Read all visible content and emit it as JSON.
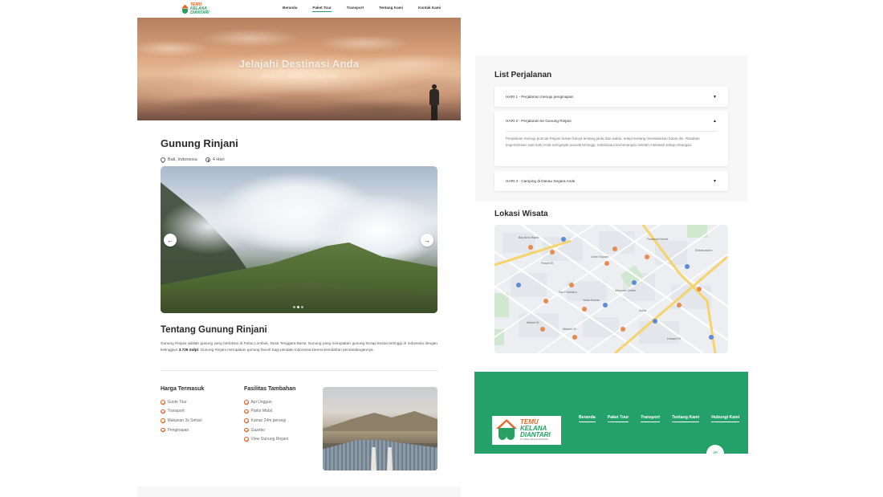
{
  "brand": {
    "logo_line1": "TEMU",
    "logo_line2": "KELANA",
    "logo_line3": "DIANTARI",
    "logo_tagline": "PT TEMU KELANA DIANTARI",
    "green": "#23a168",
    "orange": "#e4662a"
  },
  "nav": {
    "items": [
      "Beranda",
      "Paket Tour",
      "Transport",
      "Tentang Kami",
      "Kontak Kami"
    ],
    "active": "Paket Tour"
  },
  "hero": {
    "title": "Jelajahi Destinasi Anda",
    "breadcrumb": [
      "Beranda",
      "Paket Tour",
      "Detail Paket"
    ],
    "breadcrumb_sep": ">"
  },
  "destination": {
    "title": "Gunung Rinjani",
    "location": "Bali, Indonesia",
    "duration": "4 Hari",
    "gallery_prev_icon": "←",
    "gallery_next_icon": "→",
    "gallery_active_index": 1,
    "gallery_count": 3
  },
  "about": {
    "title": "Tentang Gunung Rinjani",
    "text_before": "Gunung Rinjani adalah gunung yang berlokasi di Pulau Lombok, Nusa Tenggara Barat. Gunung yang merupakan gunung berapi kedua tertinggi di Indonesia dengan ketinggian ",
    "text_bold": "3.726 mdpl",
    "text_after": ". Gunung Rinjani merupakan gunung favorit bagi pendaki Indonesia karena keindahan pemandangannya."
  },
  "included": {
    "title": "Harga Termasuk",
    "items": [
      "Guide Tour",
      "Transport",
      "Makanan 3x Sehari",
      "Penginapan"
    ]
  },
  "extras": {
    "title": "Fasilitas Tambahan",
    "items": [
      "Api Unggun",
      "Parkir Mobil",
      "Kamar 24m persegi",
      "Gazebo",
      "View Gunung Rinjani"
    ]
  },
  "itinerary": {
    "title": "List Perjalanan",
    "days": [
      {
        "label": "HARI 1 - Perjalanan menuju penginapan",
        "caret": "▼",
        "open": false,
        "body": ""
      },
      {
        "label": "HARI 2 - Perjalanan ke Gunung Rinjani",
        "caret": "▲",
        "open": true,
        "body": "Perjalanan menuju puncak Rinjani bukan hanya tentang jarak dan waktu, tetapi tentang menaklukkan batas diri. Rasakan kegembiraan saat kaki Anda menginjak puncak tertinggi, melampaui kemenangan setelah melewati setiap rintangan."
      },
      {
        "label": "HARI 3 - Camping di Danau Segara Anak",
        "caret": "▼",
        "open": false,
        "body": ""
      }
    ]
  },
  "map": {
    "title": "Lokasi Wisata",
    "labels": [
      "Bay Area Rapid",
      "Powell St",
      "Union Square",
      "San Francisco",
      "Moscone Center",
      "Yerba Buena",
      "SoMa",
      "Financial District",
      "Embarcadero",
      "Market St",
      "Mission St",
      "Howard St"
    ]
  },
  "footer": {
    "links": [
      "Beranda",
      "Paket Tour",
      "Transport",
      "Tentang Kami",
      "Hubungi Kami"
    ],
    "chat_icon": "✆"
  }
}
